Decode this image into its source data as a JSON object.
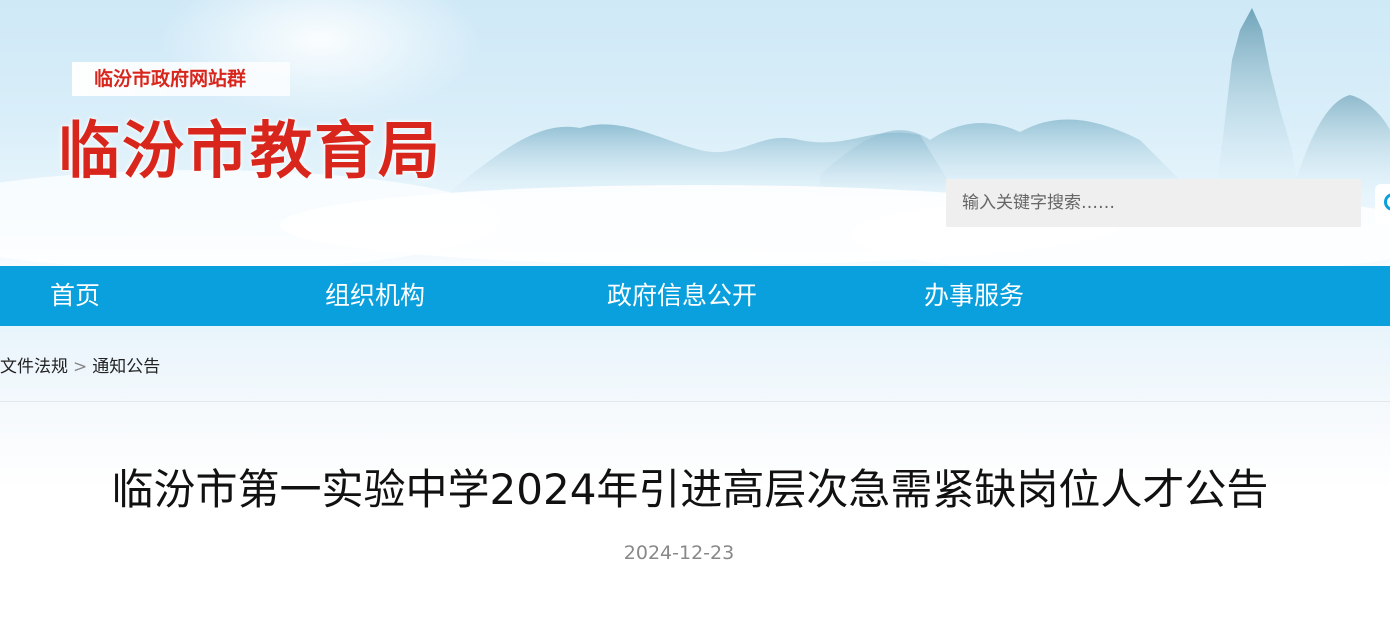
{
  "header": {
    "site_group": "临汾市政府网站群",
    "site_title": "临汾市教育局",
    "search": {
      "placeholder": "输入关键字搜索……",
      "button_icon": "search-icon"
    }
  },
  "nav": {
    "items": [
      {
        "label": "首页"
      },
      {
        "label": "组织机构"
      },
      {
        "label": "政府信息公开"
      },
      {
        "label": "办事服务"
      }
    ]
  },
  "breadcrumb": {
    "items": [
      "文件法规",
      "通知公告"
    ],
    "separator": ">"
  },
  "article": {
    "title": "临汾市第一实验中学2024年引进高层次急需紧缺岗位人才公告",
    "date": "2024-12-23"
  },
  "colors": {
    "nav_bg": "#0aa0dd",
    "title_red": "#d9261c",
    "search_icon": "#0aa0dd"
  }
}
